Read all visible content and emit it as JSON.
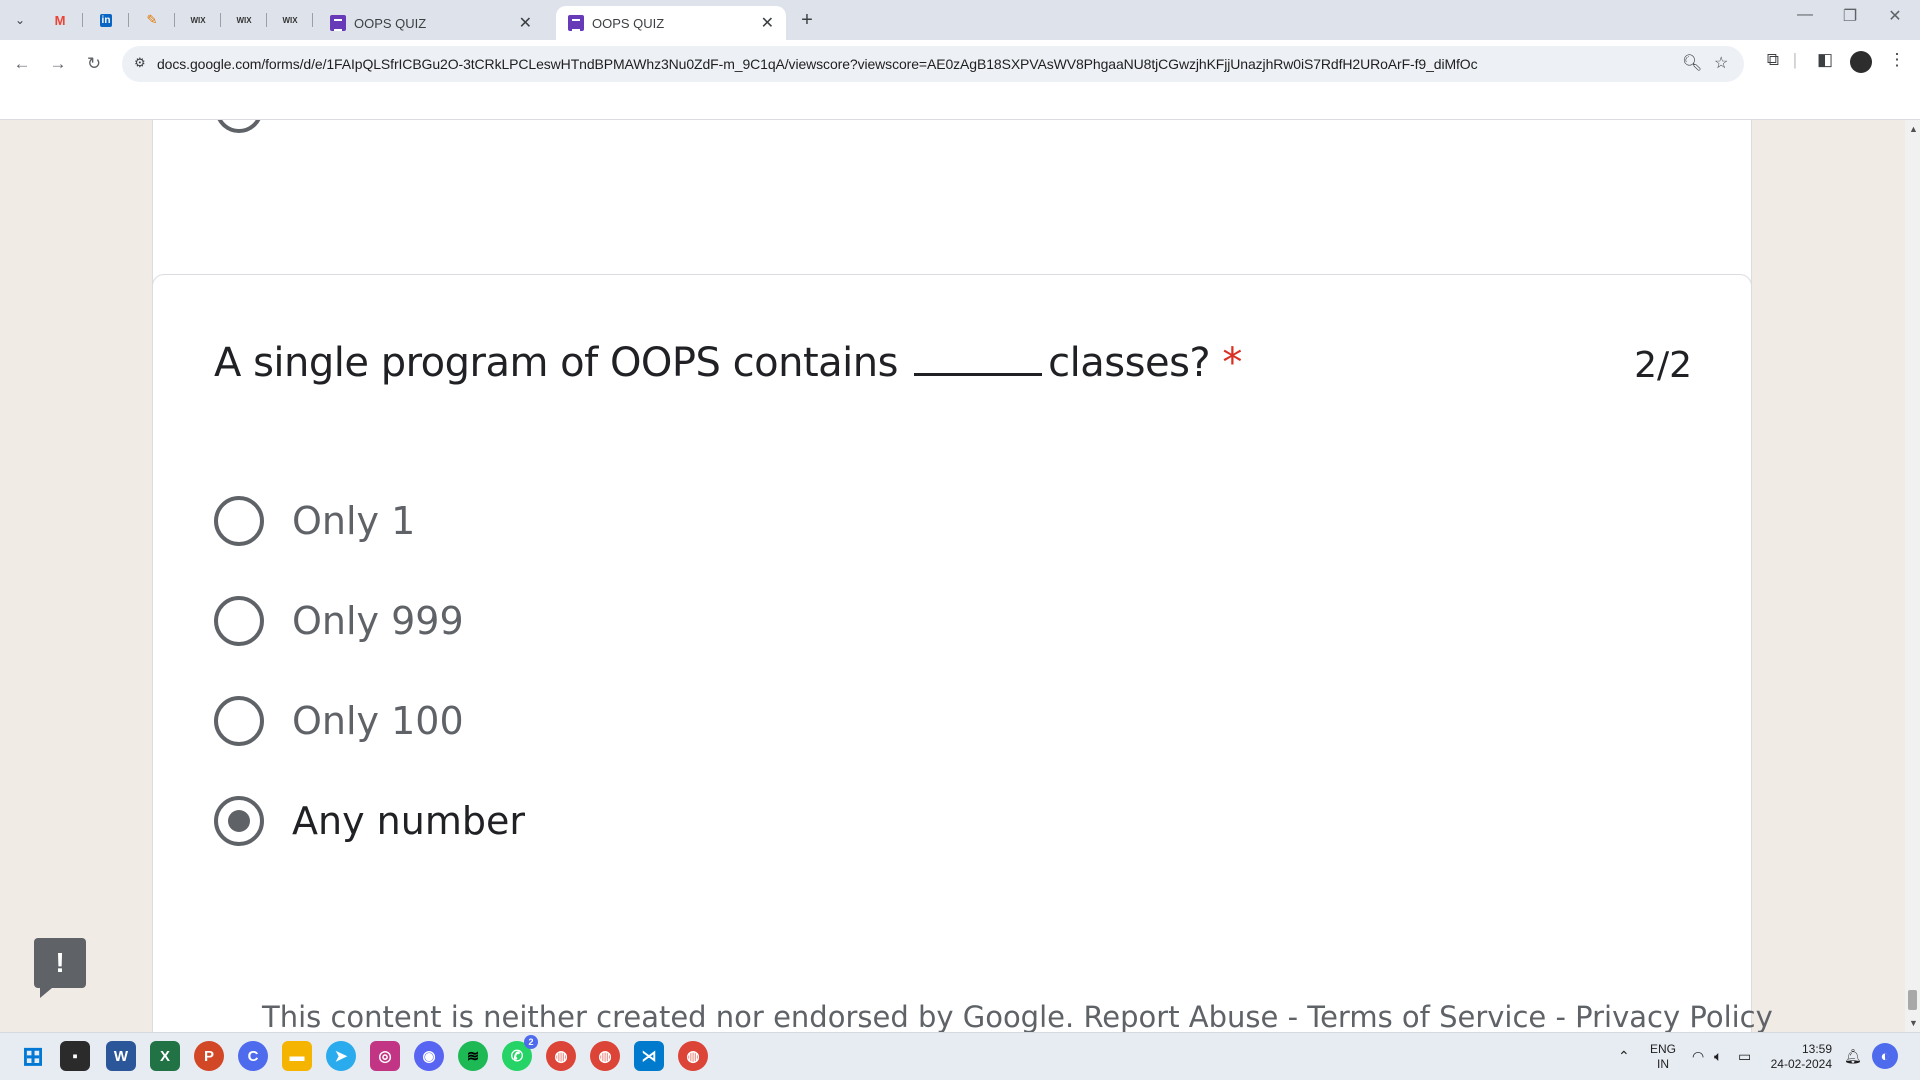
{
  "browser": {
    "tabs": [
      {
        "title": "OOPS QUIZ",
        "active": false
      },
      {
        "title": "OOPS QUIZ",
        "active": true
      }
    ],
    "pinned_tabs": [
      {
        "icon": "gmail-icon",
        "glyph": "M",
        "color": "#ea4335"
      },
      {
        "icon": "linkedin-icon",
        "glyph": "in",
        "color": "#0a66c2"
      },
      {
        "icon": "feather-icon",
        "glyph": "✎",
        "color": "#e37400"
      },
      {
        "icon": "wix-icon",
        "glyph": "WIX",
        "color": "#333333"
      },
      {
        "icon": "wix-icon",
        "glyph": "WIX",
        "color": "#333333"
      },
      {
        "icon": "wix-icon",
        "glyph": "WIX",
        "color": "#333333"
      }
    ],
    "url": "docs.google.com/forms/d/e/1FAIpQLSfrICBGu2O-3tCRkLPCLeswHTndBPMAWhz3Nu0ZdF-m_9C1qA/viewscore?viewscore=AE0zAgB18SXPVAsWV8PhgaaNU8tjCGwzjhKFjjUnazjhRw0iS7RdfH2URoArF-f9_diMfOc"
  },
  "question": {
    "title_before": "A single program of OOPS contains",
    "title_after": "classes?",
    "required_mark": "*",
    "score": "2/2",
    "options": [
      {
        "label": "Only 1",
        "selected": false
      },
      {
        "label": "Only 999",
        "selected": false
      },
      {
        "label": "Only 100",
        "selected": false
      },
      {
        "label": "Any number",
        "selected": true
      }
    ]
  },
  "feedback_button": "!",
  "footer": {
    "text": "This content is neither created nor endorsed by Google.",
    "links": [
      "Report Abuse",
      "Terms of Service",
      "Privacy Policy"
    ],
    "separator": " - "
  },
  "taskbar": {
    "apps": [
      {
        "name": "windows-start-icon",
        "glyph": "⊞",
        "color": "#0078d4"
      },
      {
        "name": "file-icon",
        "glyph": "▪",
        "color": "#2b2b2b"
      },
      {
        "name": "word-icon",
        "glyph": "W",
        "color": "#2b579a"
      },
      {
        "name": "excel-icon",
        "glyph": "X",
        "color": "#217346"
      },
      {
        "name": "powerpoint-icon",
        "glyph": "P",
        "color": "#d24726"
      },
      {
        "name": "copilot-icon",
        "glyph": "C",
        "color": "#4f6bed"
      },
      {
        "name": "file-explorer-icon",
        "glyph": "▬",
        "color": "#f5b400"
      },
      {
        "name": "telegram-icon",
        "glyph": "➤",
        "color": "#2aabee"
      },
      {
        "name": "instagram-icon",
        "glyph": "◎",
        "color": "#c13584"
      },
      {
        "name": "discord-icon",
        "glyph": "◉",
        "color": "#5865f2"
      },
      {
        "name": "spotify-icon",
        "glyph": "≋",
        "color": "#1db954"
      },
      {
        "name": "whatsapp-icon",
        "glyph": "✆",
        "color": "#25d366"
      },
      {
        "name": "chrome-icon",
        "glyph": "◍",
        "color": "#db4437"
      },
      {
        "name": "chrome-profile-icon",
        "glyph": "◍",
        "color": "#db4437"
      },
      {
        "name": "vscode-icon",
        "glyph": "⋊",
        "color": "#007acc"
      },
      {
        "name": "chrome-profile-2-icon",
        "glyph": "◍",
        "color": "#db4437"
      }
    ],
    "whatsapp_badge": "2",
    "language": "ENG",
    "region": "IN",
    "time": "13:59",
    "date": "24-02-2024"
  }
}
